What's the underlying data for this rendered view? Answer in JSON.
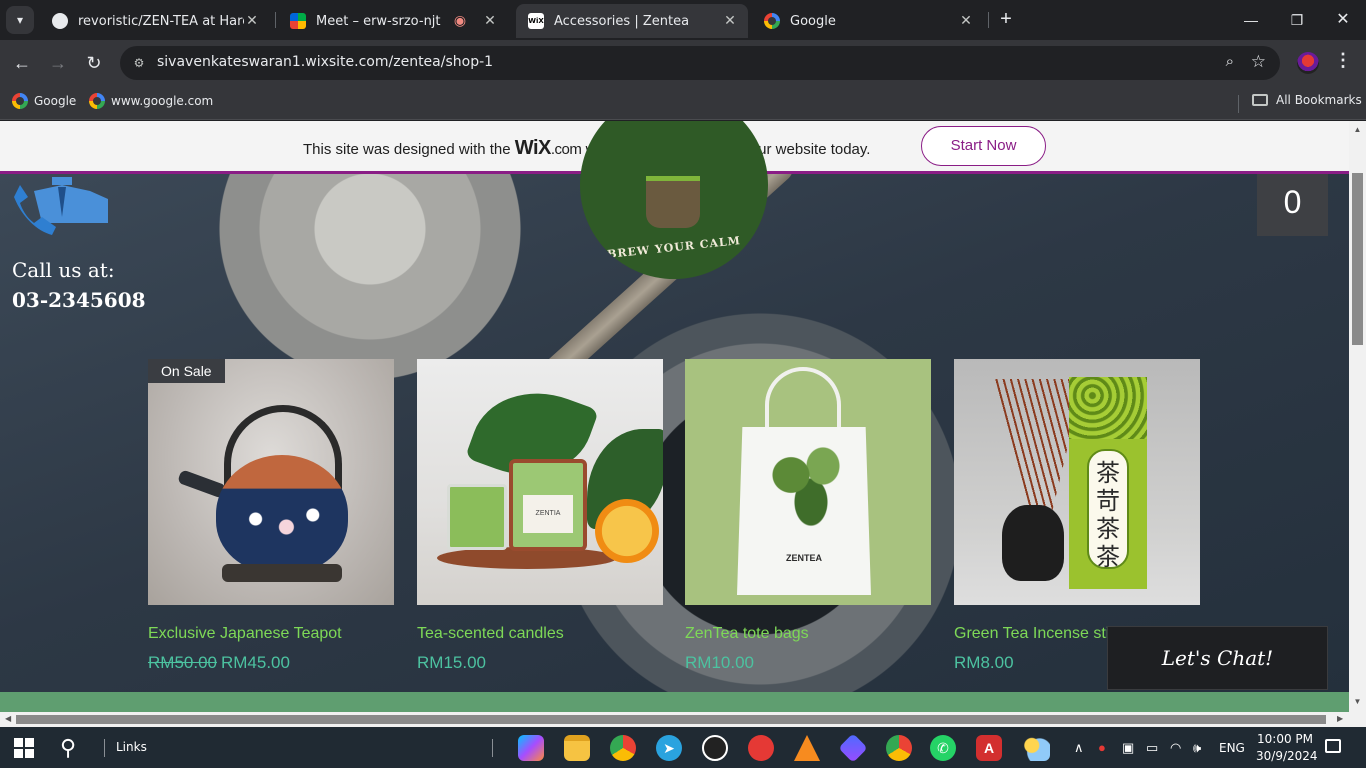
{
  "browser": {
    "tabs": [
      {
        "title": "revoristic/ZEN-TEA at Harein",
        "favicon": "github-icon",
        "active": false
      },
      {
        "title": "Meet – erw-srzo-njt",
        "favicon": "google-meet-icon",
        "active": false,
        "recording": true
      },
      {
        "title": "Accessories | Zentea",
        "favicon": "wix-icon",
        "active": true
      },
      {
        "title": "Google",
        "favicon": "google-icon",
        "active": false
      }
    ],
    "url": "sivavenkateswaran1.wixsite.com/zentea/shop-1",
    "bookmarks": [
      {
        "label": "Google",
        "icon": "google-icon"
      },
      {
        "label": "www.google.com",
        "icon": "google-icon"
      }
    ],
    "all_bookmarks_label": "All Bookmarks"
  },
  "wix_banner": {
    "text_before": "This site was designed with the",
    "brand": "WiX",
    "brand_suffix": ".com",
    "text_after": "website builder. Create your website today.",
    "button": "Start Now",
    "accent": "#8a1d86"
  },
  "site": {
    "call_label": "Call us at:",
    "phone": "03-2345608",
    "logo_tagline": "BREW YOUR CALM",
    "cart_count": "0",
    "chat_button": "Let's Chat!"
  },
  "products": [
    {
      "name": "Exclusive Japanese Teapot",
      "old_price": "RM50.00",
      "price": "RM45.00",
      "badge": "On Sale"
    },
    {
      "name": "Tea-scented candles",
      "price": "RM15.00"
    },
    {
      "name": "ZenTea tote bags",
      "price": "RM10.00",
      "bag_print": "ZENTEA"
    },
    {
      "name": "Green Tea Incense sti",
      "price": "RM8.00",
      "box_print": "茶 苛 茶 茶"
    }
  ],
  "colors": {
    "product_name": "#7ed957",
    "product_price": "#4cc2a0"
  },
  "taskbar": {
    "links_label": "Links",
    "language": "ENG",
    "time": "10:00 PM",
    "date": "30/9/2024"
  }
}
